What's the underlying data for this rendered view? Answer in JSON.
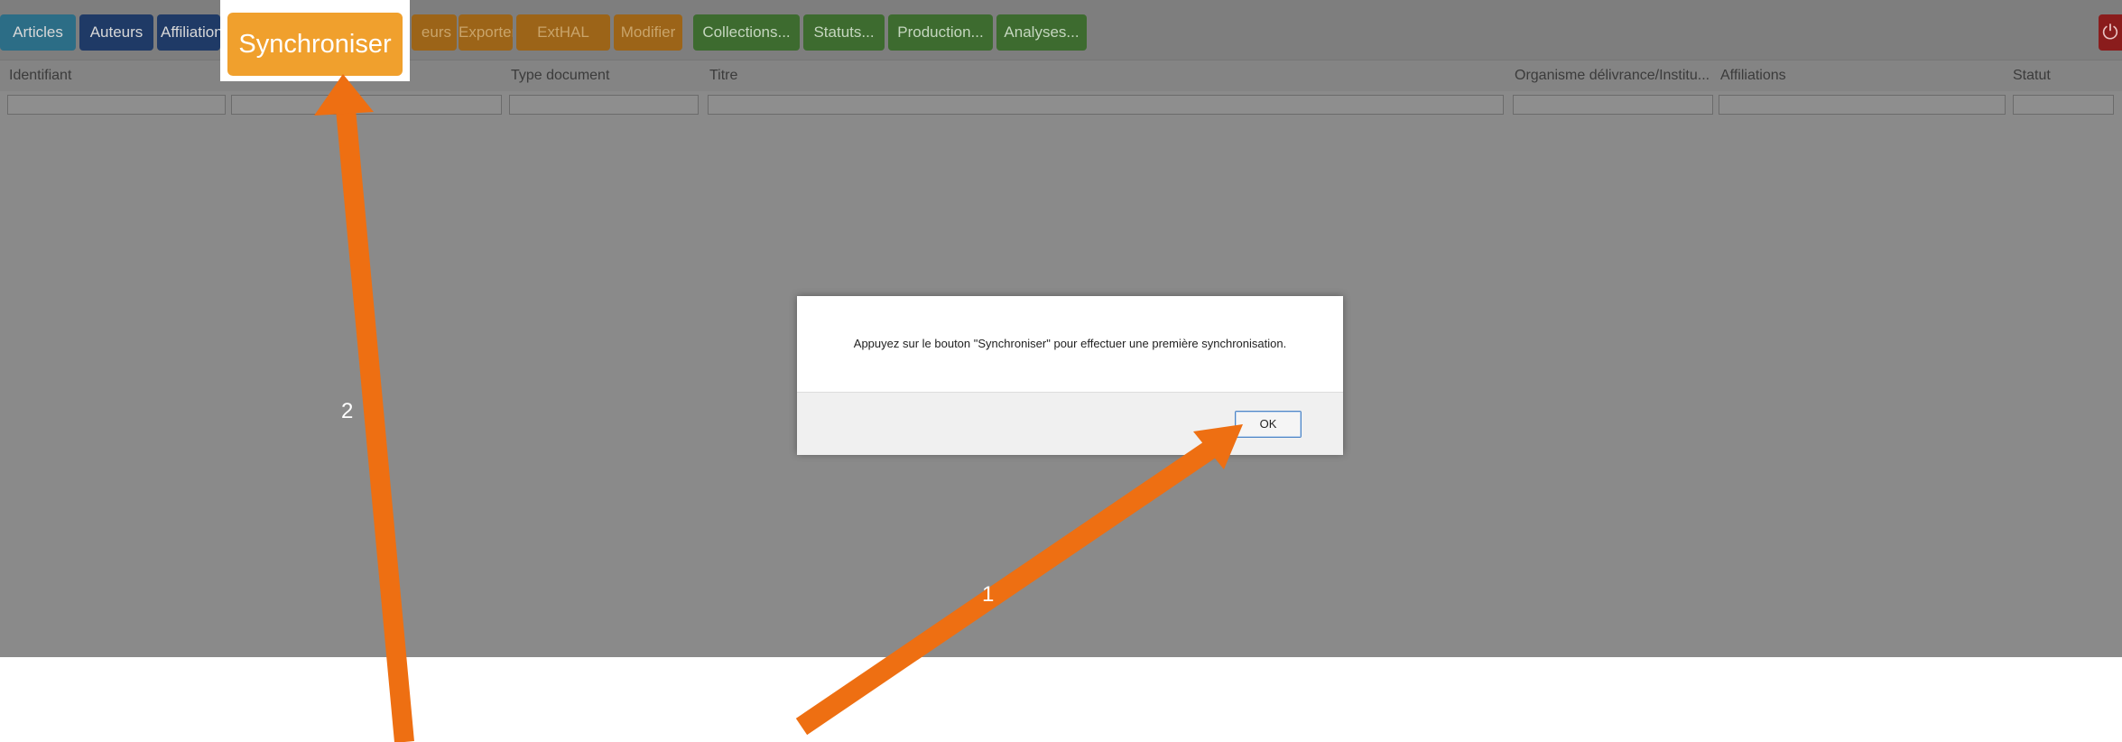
{
  "toolbar": {
    "buttons": [
      {
        "label": "Articles"
      },
      {
        "label": "Auteurs"
      },
      {
        "label": "Affiliations"
      },
      {
        "label": "Synchroniser"
      },
      {
        "label": "Exporter"
      },
      {
        "label": "ExtHAL"
      },
      {
        "label": "Modifier"
      },
      {
        "label": "Collections..."
      },
      {
        "label": "Statuts..."
      },
      {
        "label": "Production..."
      },
      {
        "label": "Analyses..."
      }
    ],
    "partial_label": "eurs",
    "power_icon": "power-icon"
  },
  "table": {
    "columns": [
      {
        "label": "Identifiant"
      },
      {
        "label": ""
      },
      {
        "label": "Type document"
      },
      {
        "label": "Titre"
      },
      {
        "label": "Organisme délivrance/Institu..."
      },
      {
        "label": "Affiliations"
      },
      {
        "label": "Statut"
      }
    ]
  },
  "dialog": {
    "message": "Appuyez sur le bouton \"Synchroniser\" pour effectuer une première synchronisation.",
    "ok_label": "OK"
  },
  "annotations": {
    "arrow_1_label": "1",
    "arrow_2_label": "2",
    "color": "#ee6f12"
  },
  "colors": {
    "sync_button": "#f0a02d",
    "overlay_gray": "#8a8a8a"
  }
}
